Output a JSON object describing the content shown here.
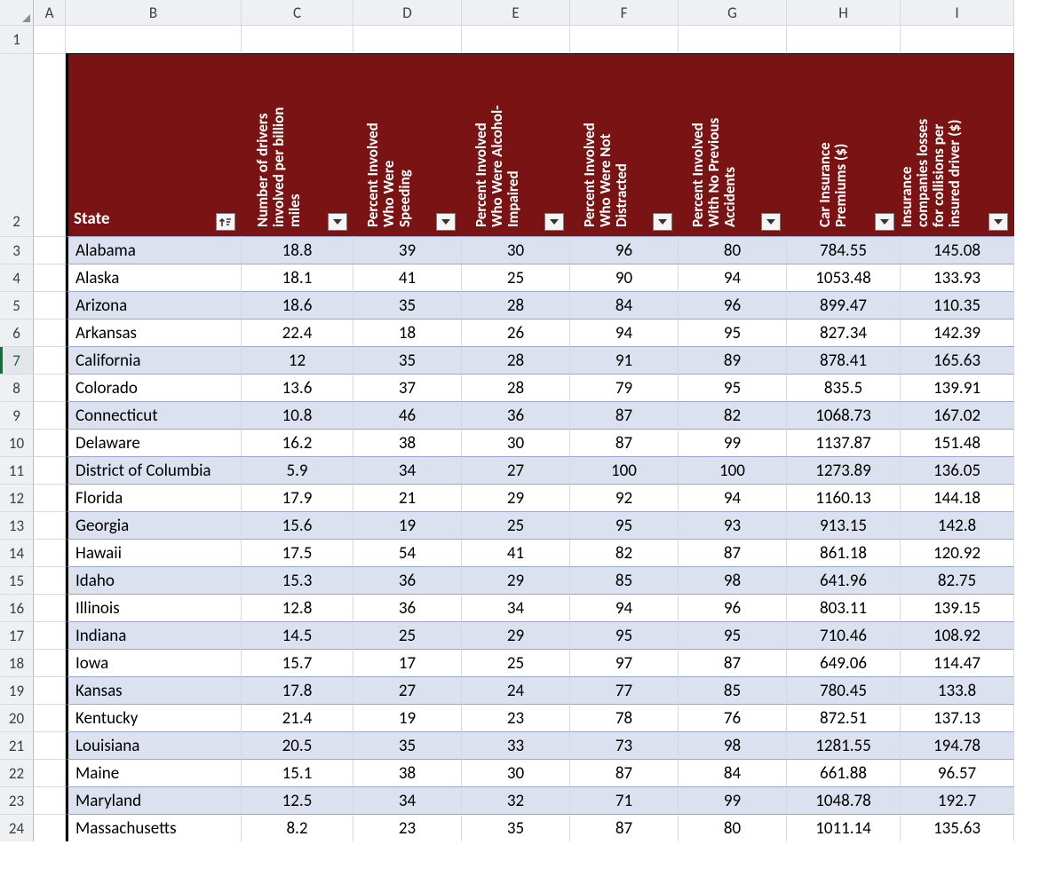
{
  "columns": {
    "letters": [
      "A",
      "B",
      "C",
      "D",
      "E",
      "F",
      "G",
      "H",
      "I"
    ],
    "widths_class": [
      "wA",
      "wB",
      "wC",
      "wD",
      "wE",
      "wF",
      "wG",
      "wH",
      "wI"
    ]
  },
  "row_numbers": [
    "1",
    "2",
    "3",
    "4",
    "5",
    "6",
    "7",
    "8",
    "9",
    "10",
    "11",
    "12",
    "13",
    "14",
    "15",
    "16",
    "17",
    "18",
    "19",
    "20",
    "21",
    "22",
    "23",
    "24"
  ],
  "selected_row_index": 6,
  "headers": {
    "B": "State",
    "C": "Number of drivers\ninvolved per billion\nmiles",
    "D": "Percent Involved\nWho Were\nSpeeding",
    "E": "Percent Involved\nWho Were Alcohol-\nImpaired",
    "F": "Percent Involved\nWho Were Not\nDistracted",
    "G": "Percent Involved\nWith No Previous\nAccidents",
    "H": "Car Insurance\nPremiums ($)",
    "I": "Insurance\ncompanies losses\nfor collisions per\ninsured driver ($)"
  },
  "filter_sorted_column": "B",
  "rows": [
    {
      "state": "Alabama",
      "c": "18.8",
      "d": "39",
      "e": "30",
      "f": "96",
      "g": "80",
      "h": "784.55",
      "i": "145.08"
    },
    {
      "state": "Alaska",
      "c": "18.1",
      "d": "41",
      "e": "25",
      "f": "90",
      "g": "94",
      "h": "1053.48",
      "i": "133.93"
    },
    {
      "state": "Arizona",
      "c": "18.6",
      "d": "35",
      "e": "28",
      "f": "84",
      "g": "96",
      "h": "899.47",
      "i": "110.35"
    },
    {
      "state": "Arkansas",
      "c": "22.4",
      "d": "18",
      "e": "26",
      "f": "94",
      "g": "95",
      "h": "827.34",
      "i": "142.39"
    },
    {
      "state": "California",
      "c": "12",
      "d": "35",
      "e": "28",
      "f": "91",
      "g": "89",
      "h": "878.41",
      "i": "165.63"
    },
    {
      "state": "Colorado",
      "c": "13.6",
      "d": "37",
      "e": "28",
      "f": "79",
      "g": "95",
      "h": "835.5",
      "i": "139.91"
    },
    {
      "state": "Connecticut",
      "c": "10.8",
      "d": "46",
      "e": "36",
      "f": "87",
      "g": "82",
      "h": "1068.73",
      "i": "167.02"
    },
    {
      "state": "Delaware",
      "c": "16.2",
      "d": "38",
      "e": "30",
      "f": "87",
      "g": "99",
      "h": "1137.87",
      "i": "151.48"
    },
    {
      "state": "District of Columbia",
      "c": "5.9",
      "d": "34",
      "e": "27",
      "f": "100",
      "g": "100",
      "h": "1273.89",
      "i": "136.05"
    },
    {
      "state": "Florida",
      "c": "17.9",
      "d": "21",
      "e": "29",
      "f": "92",
      "g": "94",
      "h": "1160.13",
      "i": "144.18"
    },
    {
      "state": "Georgia",
      "c": "15.6",
      "d": "19",
      "e": "25",
      "f": "95",
      "g": "93",
      "h": "913.15",
      "i": "142.8"
    },
    {
      "state": "Hawaii",
      "c": "17.5",
      "d": "54",
      "e": "41",
      "f": "82",
      "g": "87",
      "h": "861.18",
      "i": "120.92"
    },
    {
      "state": "Idaho",
      "c": "15.3",
      "d": "36",
      "e": "29",
      "f": "85",
      "g": "98",
      "h": "641.96",
      "i": "82.75"
    },
    {
      "state": "Illinois",
      "c": "12.8",
      "d": "36",
      "e": "34",
      "f": "94",
      "g": "96",
      "h": "803.11",
      "i": "139.15"
    },
    {
      "state": "Indiana",
      "c": "14.5",
      "d": "25",
      "e": "29",
      "f": "95",
      "g": "95",
      "h": "710.46",
      "i": "108.92"
    },
    {
      "state": "Iowa",
      "c": "15.7",
      "d": "17",
      "e": "25",
      "f": "97",
      "g": "87",
      "h": "649.06",
      "i": "114.47"
    },
    {
      "state": "Kansas",
      "c": "17.8",
      "d": "27",
      "e": "24",
      "f": "77",
      "g": "85",
      "h": "780.45",
      "i": "133.8"
    },
    {
      "state": "Kentucky",
      "c": "21.4",
      "d": "19",
      "e": "23",
      "f": "78",
      "g": "76",
      "h": "872.51",
      "i": "137.13"
    },
    {
      "state": "Louisiana",
      "c": "20.5",
      "d": "35",
      "e": "33",
      "f": "73",
      "g": "98",
      "h": "1281.55",
      "i": "194.78"
    },
    {
      "state": "Maine",
      "c": "15.1",
      "d": "38",
      "e": "30",
      "f": "87",
      "g": "84",
      "h": "661.88",
      "i": "96.57"
    },
    {
      "state": "Maryland",
      "c": "12.5",
      "d": "34",
      "e": "32",
      "f": "71",
      "g": "99",
      "h": "1048.78",
      "i": "192.7"
    },
    {
      "state": "Massachusetts",
      "c": "8.2",
      "d": "23",
      "e": "35",
      "f": "87",
      "g": "80",
      "h": "1011.14",
      "i": "135.63"
    }
  ]
}
